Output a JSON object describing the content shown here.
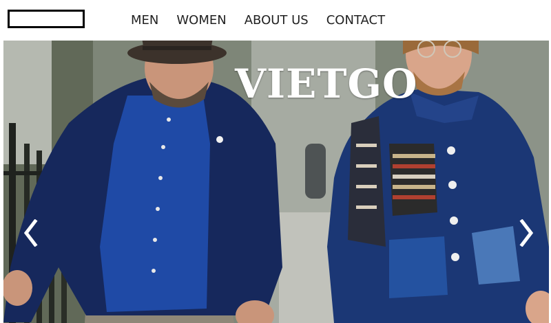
{
  "header": {
    "nav": [
      {
        "id": "men",
        "label": "MEN"
      },
      {
        "id": "women",
        "label": "WOMEN"
      },
      {
        "id": "about",
        "label": "ABOUT US"
      },
      {
        "id": "contact",
        "label": "CONTACT"
      }
    ]
  },
  "hero": {
    "title": "VIETGO",
    "prev_icon": "chevron-left-icon",
    "next_icon": "chevron-right-icon"
  },
  "colors": {
    "nav_text": "#222222",
    "title_text": "#ffffff",
    "jacket_navy": "#16285c",
    "shirt_blue": "#1f4aa6"
  }
}
